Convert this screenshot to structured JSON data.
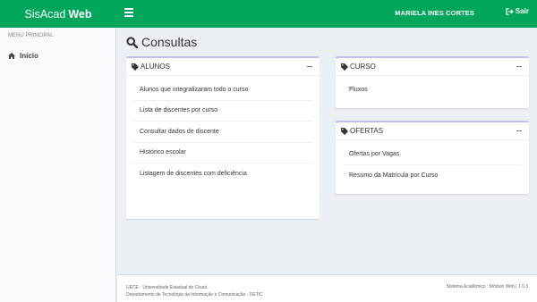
{
  "app": {
    "brand_light": "SisAcad",
    "brand_bold": "Web"
  },
  "header": {
    "user_name": "MARIELA INES CORTES",
    "logout_label": "Sair"
  },
  "sidebar": {
    "header": "MENU PRINCIPAL",
    "items": [
      {
        "label": "Início",
        "icon": "home-icon"
      }
    ]
  },
  "page": {
    "title": "Consultas"
  },
  "boxes": {
    "alunos": {
      "title": "ALUNOS",
      "links": [
        "Alunos que integralizaram todo o curso",
        "Lista de discentes por curso",
        "Consultar dados de discente",
        "Histórico escolar",
        "Listagem de discentes com deficiência"
      ]
    },
    "curso": {
      "title": "CURSO",
      "links": [
        "Fluxos"
      ]
    },
    "ofertas": {
      "title": "OFERTAS",
      "links": [
        "Ofertas por Vagas",
        "Resumo da Matrícula por Curso"
      ]
    }
  },
  "footer": {
    "line1": "UECE - Universidade Estadual do Ceará",
    "line2": "Departamento de Tecnologia da Informação e Comunicação - DETIC",
    "right": "Sistema Acadêmico : Módulo Web | 1.0.3"
  },
  "colors": {
    "topbar": "#00a65a",
    "background": "#ecf0f5",
    "box_border": "#c2c0ea"
  }
}
